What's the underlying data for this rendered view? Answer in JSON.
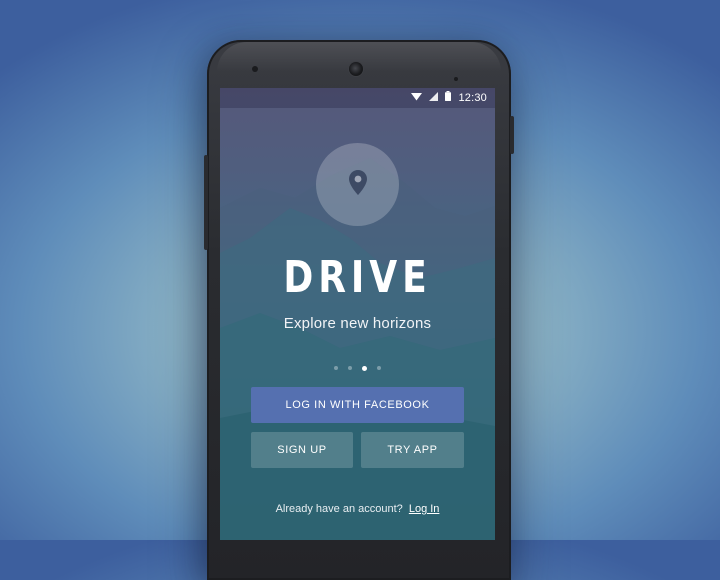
{
  "status_bar": {
    "time": "12:30",
    "icons": [
      "wifi-icon",
      "signal-icon",
      "battery-icon"
    ]
  },
  "app": {
    "logo_icon": "map-pin-icon",
    "title": "DRIVE",
    "tagline": "Explore new horizons"
  },
  "pager": {
    "count": 4,
    "active_index": 2
  },
  "buttons": {
    "facebook_label": "LOG IN WITH FACEBOOK",
    "signup_label": "SIGN UP",
    "try_label": "TRY APP"
  },
  "footer": {
    "prompt": "Already have an account?",
    "login_link": "Log In"
  },
  "colors": {
    "facebook_button": "#5570b0",
    "secondary_button": "rgba(255,255,255,0.18)",
    "text": "#ffffff"
  }
}
